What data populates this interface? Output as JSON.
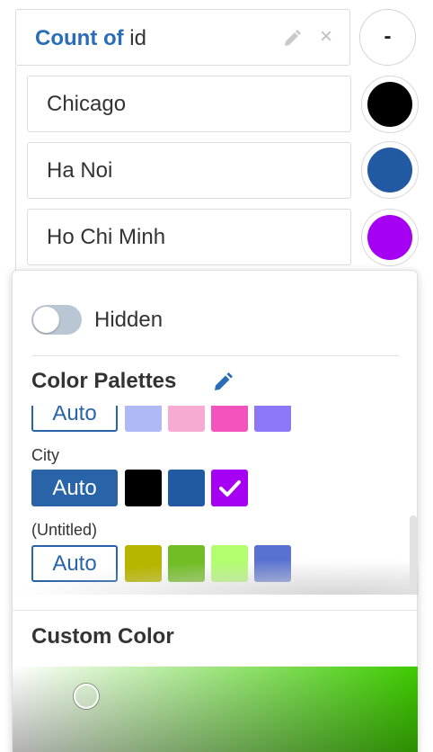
{
  "measure": {
    "keyword": "Count of",
    "field": "id",
    "remove_label": "×",
    "collapse_label": "-"
  },
  "rows": [
    {
      "label": "Chicago",
      "color": "#000000"
    },
    {
      "label": "Ha Noi",
      "color": "#2159a3"
    },
    {
      "label": "Ho Chi Minh",
      "color": "#a600f2"
    }
  ],
  "popover": {
    "toggle_label": "Hidden",
    "toggle_on": false,
    "palettes_heading": "Color Palettes",
    "palettes": [
      {
        "name": "",
        "auto_label": "Auto",
        "active": false,
        "colors": [
          "#aeb9f5",
          "#f7abd3",
          "#f253bd",
          "#8c78f7"
        ]
      },
      {
        "name": "City",
        "auto_label": "Auto",
        "active": true,
        "colors": [
          "#000000",
          "#2159a3",
          "#a600f2"
        ],
        "selected_index": 2
      },
      {
        "name": "(Untitled)",
        "auto_label": "Auto",
        "active": false,
        "colors": [
          "#b6b500",
          "#72bd26",
          "#b2fe6e",
          "#5972d1"
        ]
      }
    ],
    "custom_heading": "Custom Color"
  },
  "accent_color": "#2a64a8"
}
